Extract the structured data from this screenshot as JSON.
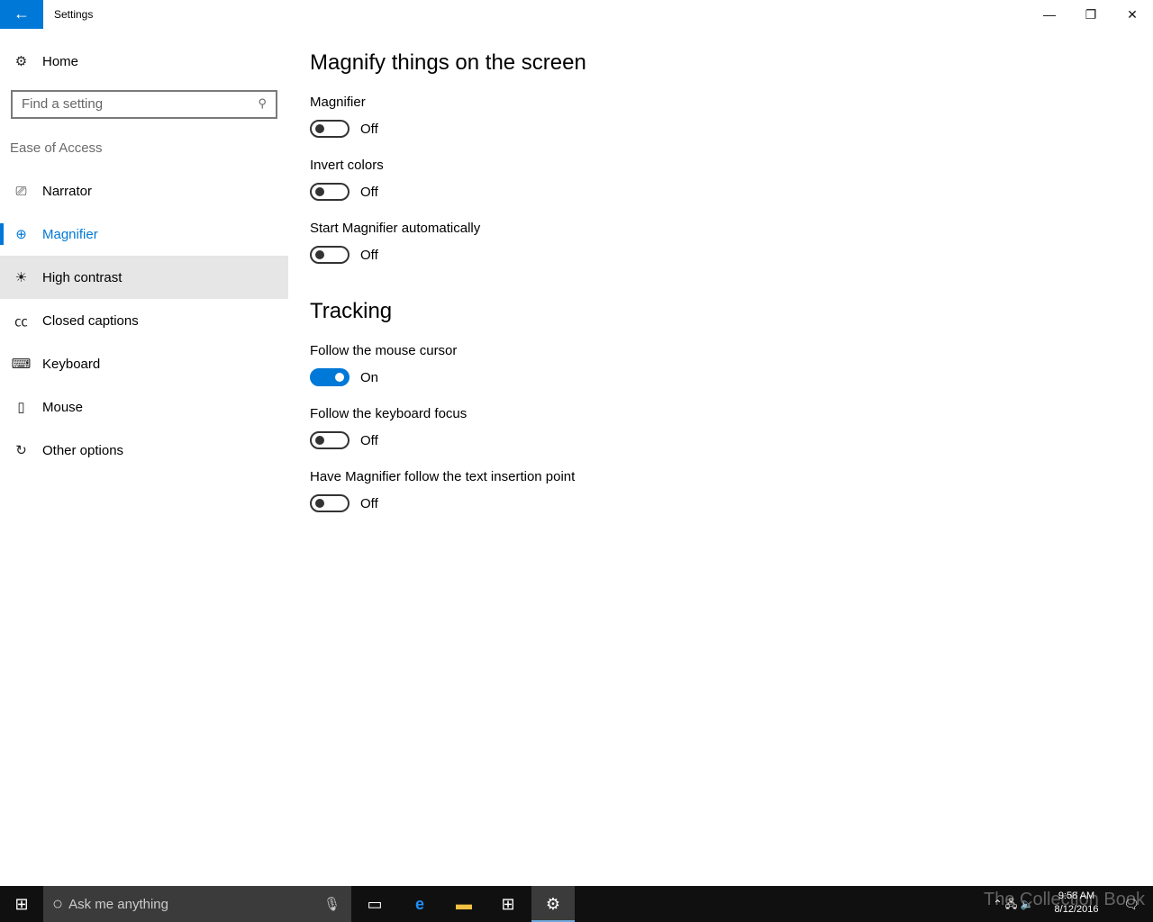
{
  "window": {
    "title": "Settings",
    "back": "←",
    "minimize": "—",
    "restore": "❐",
    "close": "✕"
  },
  "sidebar": {
    "home": {
      "label": "Home",
      "icon": "gear-icon"
    },
    "search": {
      "placeholder": "Find a setting",
      "icon": "search-icon"
    },
    "section": "Ease of Access",
    "items": [
      {
        "label": "Narrator",
        "icon": "narrator-icon",
        "glyph": "⎚"
      },
      {
        "label": "Magnifier",
        "icon": "magnifier-icon",
        "glyph": "⊕"
      },
      {
        "label": "High contrast",
        "icon": "high-contrast-icon",
        "glyph": "☀"
      },
      {
        "label": "Closed captions",
        "icon": "closed-captions-icon",
        "glyph": "㏄"
      },
      {
        "label": "Keyboard",
        "icon": "keyboard-icon",
        "glyph": "⌨"
      },
      {
        "label": "Mouse",
        "icon": "mouse-icon",
        "glyph": "▯"
      },
      {
        "label": "Other options",
        "icon": "other-options-icon",
        "glyph": "↻"
      }
    ],
    "selected": "Magnifier",
    "hovered": "High contrast"
  },
  "main": {
    "heading1": "Magnify things on the screen",
    "settings1": [
      {
        "label": "Magnifier",
        "state": "Off",
        "on": false
      },
      {
        "label": "Invert colors",
        "state": "Off",
        "on": false
      },
      {
        "label": "Start Magnifier automatically",
        "state": "Off",
        "on": false
      }
    ],
    "heading2": "Tracking",
    "settings2": [
      {
        "label": "Follow the mouse cursor",
        "state": "On",
        "on": true
      },
      {
        "label": "Follow the keyboard focus",
        "state": "Off",
        "on": false
      },
      {
        "label": "Have Magnifier follow the text insertion point",
        "state": "Off",
        "on": false
      }
    ]
  },
  "taskbar": {
    "search_placeholder": "Ask me anything",
    "time": "9:58 AM",
    "date": "8/12/2016",
    "watermark": "The Collection Book",
    "accent": "#0078d7"
  }
}
